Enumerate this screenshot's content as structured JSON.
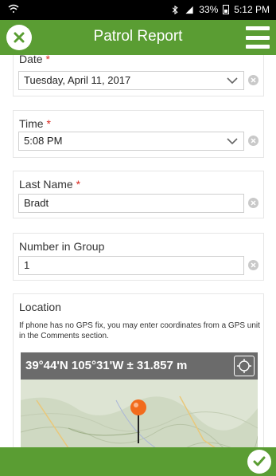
{
  "status_bar": {
    "battery": "33%",
    "time": "5:12 PM"
  },
  "header": {
    "title": "Patrol Report",
    "close_icon": "close-icon",
    "menu_icon": "hamburger-menu-icon"
  },
  "form": {
    "date": {
      "label": "Date",
      "required": "*",
      "value": "Tuesday, April 11, 2017"
    },
    "time": {
      "label": "Time",
      "required": "*",
      "value": "5:08 PM"
    },
    "last_name": {
      "label": "Last Name",
      "required": "*",
      "value": "Bradt"
    },
    "number_in_group": {
      "label": "Number in Group",
      "value": "1"
    },
    "location": {
      "label": "Location",
      "help": "If phone has no GPS fix, you may enter coordinates from a GPS unit in the Comments section.",
      "coordinates": "39°44'N 105°31'W ± 31.857 m"
    }
  },
  "footer": {
    "submit_icon": "checkmark-icon"
  },
  "colors": {
    "brand_green": "#5a9d33",
    "required_red": "#d9281f",
    "pin_orange": "#f26b1d"
  }
}
